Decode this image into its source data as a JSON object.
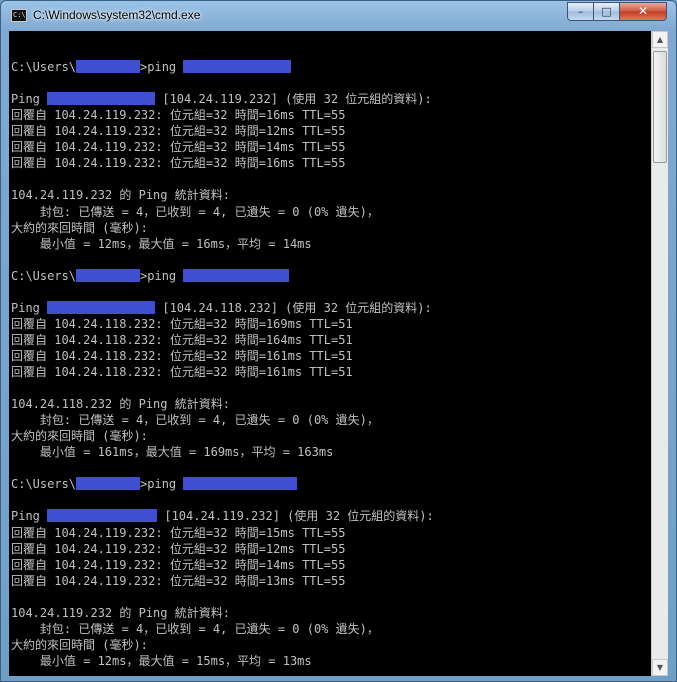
{
  "window": {
    "title": "C:\\Windows\\system32\\cmd.exe",
    "icon_text": "C:\\",
    "controls": {
      "minimize": "–",
      "maximize": "□",
      "close": "✕"
    }
  },
  "redaction_color": "#3f4fd2",
  "console_lines": [
    {
      "text": ""
    },
    {
      "segments": [
        {
          "t": "C:\\Users\\"
        },
        {
          "r": 64
        },
        {
          "t": ">ping "
        },
        {
          "r": 108
        }
      ]
    },
    {
      "text": ""
    },
    {
      "segments": [
        {
          "t": "Ping "
        },
        {
          "r": 108
        },
        {
          "t": " [104.24.119.232] (使用 32 位元組的資料):"
        }
      ]
    },
    {
      "text": "回覆自 104.24.119.232: 位元組=32 時間=16ms TTL=55"
    },
    {
      "text": "回覆自 104.24.119.232: 位元組=32 時間=12ms TTL=55"
    },
    {
      "text": "回覆自 104.24.119.232: 位元組=32 時間=14ms TTL=55"
    },
    {
      "text": "回覆自 104.24.119.232: 位元組=32 時間=16ms TTL=55"
    },
    {
      "text": ""
    },
    {
      "text": "104.24.119.232 的 Ping 統計資料:"
    },
    {
      "text": "    封包: 已傳送 = 4，已收到 = 4, 已遺失 = 0 (0% 遺失)，"
    },
    {
      "text": "大約的來回時間 (毫秒):"
    },
    {
      "text": "    最小值 = 12ms，最大值 = 16ms，平均 = 14ms"
    },
    {
      "text": ""
    },
    {
      "segments": [
        {
          "t": "C:\\Users\\"
        },
        {
          "r": 64
        },
        {
          "t": ">ping "
        },
        {
          "r": 106
        }
      ]
    },
    {
      "text": ""
    },
    {
      "segments": [
        {
          "t": "Ping "
        },
        {
          "r": 108
        },
        {
          "t": " [104.24.118.232] (使用 32 位元組的資料):"
        }
      ]
    },
    {
      "text": "回覆自 104.24.118.232: 位元組=32 時間=169ms TTL=51"
    },
    {
      "text": "回覆自 104.24.118.232: 位元組=32 時間=164ms TTL=51"
    },
    {
      "text": "回覆自 104.24.118.232: 位元組=32 時間=161ms TTL=51"
    },
    {
      "text": "回覆自 104.24.118.232: 位元組=32 時間=161ms TTL=51"
    },
    {
      "text": ""
    },
    {
      "text": "104.24.118.232 的 Ping 統計資料:"
    },
    {
      "text": "    封包: 已傳送 = 4，已收到 = 4, 已遺失 = 0 (0% 遺失)，"
    },
    {
      "text": "大約的來回時間 (毫秒):"
    },
    {
      "text": "    最小值 = 161ms，最大值 = 169ms，平均 = 163ms"
    },
    {
      "text": ""
    },
    {
      "segments": [
        {
          "t": "C:\\Users\\"
        },
        {
          "r": 64
        },
        {
          "t": ">ping "
        },
        {
          "r": 114
        }
      ]
    },
    {
      "text": ""
    },
    {
      "segments": [
        {
          "t": "Ping "
        },
        {
          "r": 110
        },
        {
          "t": " [104.24.119.232] (使用 32 位元組的資料):"
        }
      ]
    },
    {
      "text": "回覆自 104.24.119.232: 位元組=32 時間=15ms TTL=55"
    },
    {
      "text": "回覆自 104.24.119.232: 位元組=32 時間=12ms TTL=55"
    },
    {
      "text": "回覆自 104.24.119.232: 位元組=32 時間=14ms TTL=55"
    },
    {
      "text": "回覆自 104.24.119.232: 位元組=32 時間=13ms TTL=55"
    },
    {
      "text": ""
    },
    {
      "text": "104.24.119.232 的 Ping 統計資料:"
    },
    {
      "text": "    封包: 已傳送 = 4，已收到 = 4, 已遺失 = 0 (0% 遺失)，"
    },
    {
      "text": "大約的來回時間 (毫秒):"
    },
    {
      "text": "    最小值 = 12ms，最大值 = 15ms，平均 = 13ms"
    }
  ],
  "scrollbar": {
    "up_icon": "▲",
    "down_icon": "▼"
  }
}
